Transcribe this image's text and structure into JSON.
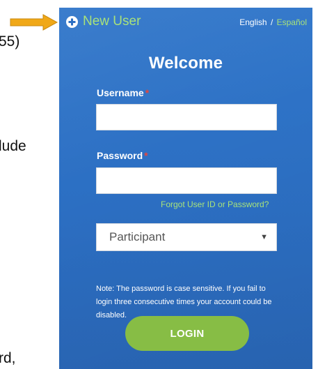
{
  "doc_fragments": [
    {
      "text": "55)"
    },
    {
      "text": "lude"
    },
    {
      "text": "rd,"
    }
  ],
  "login": {
    "new_user_label": "New User",
    "lang_english": "English",
    "lang_separator": "/",
    "lang_spanish": "Español",
    "welcome_title": "Welcome",
    "username_label": "Username",
    "password_label": "Password",
    "required_mark": "*",
    "username_value": "",
    "password_value": "",
    "forgot_link": "Forgot User ID or Password?",
    "role_selected": "Participant",
    "note": "Note: The password is case sensitive. If you fail to login three consecutive times your account could be disabled.",
    "login_button": "LOGIN"
  },
  "colors": {
    "panel_blue": "#2c6fc3",
    "accent_green": "#a8e27a",
    "button_green": "#87bd45",
    "arrow_gold": "#f0a818",
    "required_red": "#e8463b"
  },
  "icons": {
    "new_user": "plus-circle-icon",
    "select_caret": "caret-down-icon",
    "annotation": "arrow-right-icon"
  }
}
